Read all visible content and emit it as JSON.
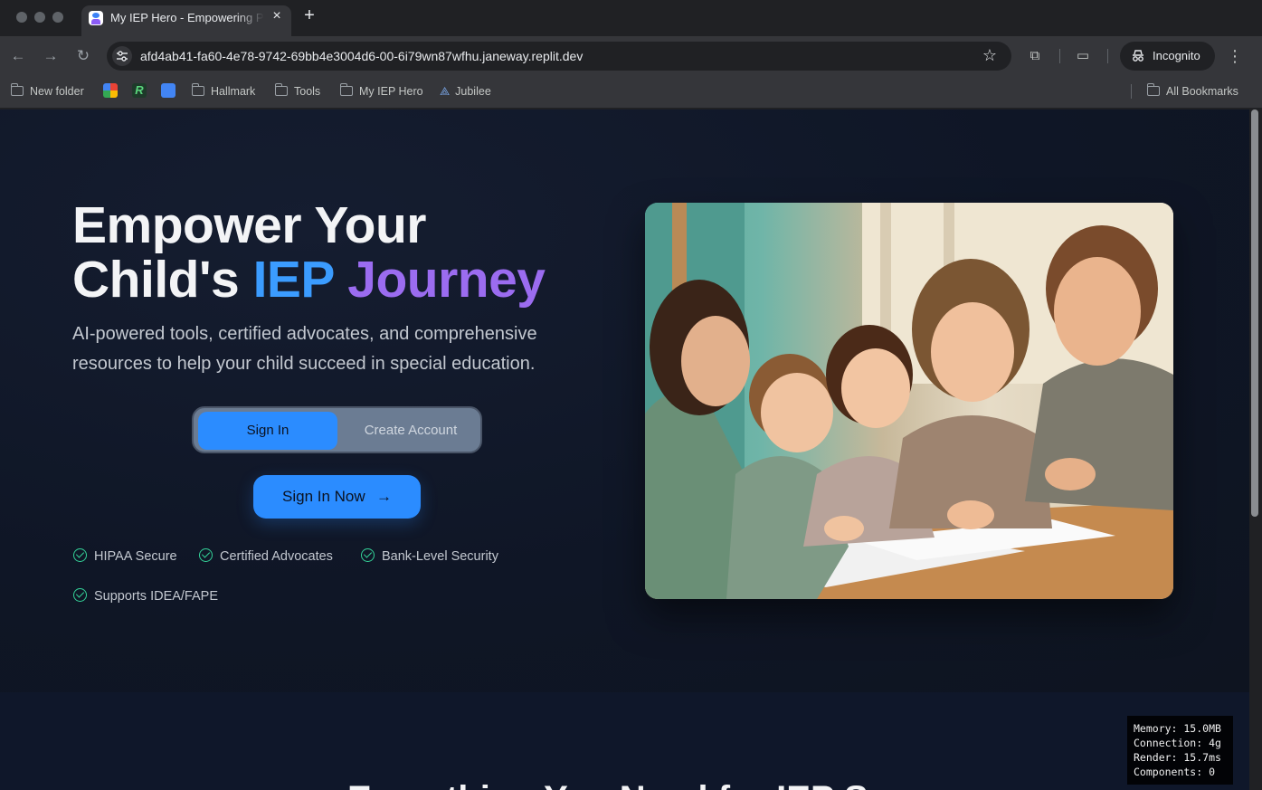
{
  "browser": {
    "tab_title": "My IEP Hero - Empowering Parents",
    "url": "afd4ab41-fa60-4e78-9742-69bb4e3004d6-00-6i79wn87wfhu.janeway.replit.dev",
    "incognito_label": "Incognito",
    "bookmarks": [
      "New folder",
      "Hallmark",
      "Tools",
      "My IEP Hero",
      "Jubilee"
    ],
    "all_bookmarks_label": "All Bookmarks"
  },
  "hero": {
    "title_line1": "Empower Your",
    "title_line2_a": "Child's",
    "title_line2_b": "IEP",
    "title_line2_c": "Journey",
    "subtitle": "AI-powered tools, certified advocates, and comprehensive resources to help your child succeed in special education.",
    "toggle": {
      "signin": "Sign In",
      "create": "Create Account",
      "selected": "Sign In"
    },
    "cta_label": "Sign In Now",
    "features": [
      "HIPAA Secure",
      "Certified Advocates",
      "Bank-Level Security",
      "Supports IDEA/FAPE"
    ]
  },
  "section2": {
    "title": "Everything You Need for IEP Success"
  },
  "perf": {
    "memory": "Memory: 15.0MB",
    "connection": "Connection: 4g",
    "render": "Render: 15.7ms",
    "components": "Components: 0"
  },
  "colors": {
    "accent_blue": "#2b8cff",
    "accent_purple": "#9b6cf0",
    "check_green": "#34d399",
    "page_bg": "#0f172a"
  }
}
